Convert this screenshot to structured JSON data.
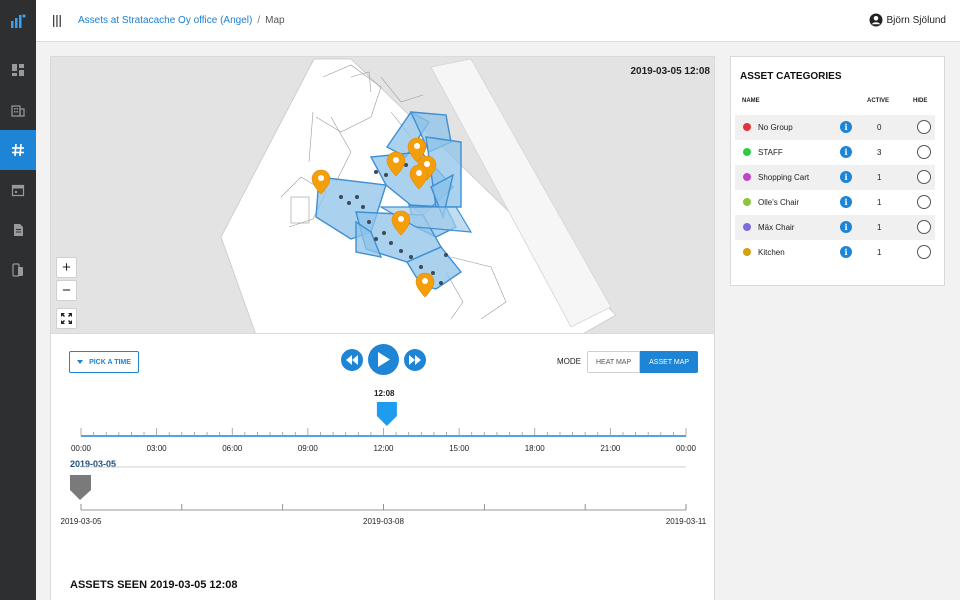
{
  "header": {
    "breadcrumb_link": "Assets at Stratacache Oy office (Angel)",
    "breadcrumb_sep": "/",
    "breadcrumb_current": "Map",
    "user_name": "Björn Sjölund"
  },
  "sidebar": {
    "items": [
      {
        "icon": "dashboard-icon"
      },
      {
        "icon": "building-icon"
      },
      {
        "icon": "hash-icon",
        "active": true
      },
      {
        "icon": "calendar-icon"
      },
      {
        "icon": "document-icon"
      },
      {
        "icon": "devices-icon"
      }
    ]
  },
  "map": {
    "timestamp": "2019-03-05 12:08",
    "zoom_in": "+",
    "zoom_out": "−",
    "marker_color": "#f59e0b",
    "zone_color": "#8ec3ea"
  },
  "controls": {
    "pick_time_label": "PICK A TIME",
    "mode_label": "MODE",
    "mode_options": [
      "HEAT MAP",
      "ASSET MAP"
    ],
    "mode_selected": "ASSET MAP",
    "accent_color": "#1d84d6"
  },
  "timeline": {
    "current_time": "12:08",
    "current_hour_fraction": 0.5056,
    "hour_labels": [
      "00:00",
      "03:00",
      "06:00",
      "09:00",
      "12:00",
      "15:00",
      "18:00",
      "21:00",
      "00:00"
    ],
    "selected_date": "2019-03-05",
    "date_labels": [
      "2019-03-05",
      "2019-03-08",
      "2019-03-11"
    ]
  },
  "assets_seen": "ASSETS SEEN 2019-03-05 12:08",
  "categories": {
    "title": "ASSET CATEGORIES",
    "col_name": "NAME",
    "col_active": "ACTIVE",
    "col_hide": "HIDE",
    "rows": [
      {
        "name": "No Group",
        "color": "#e2333a",
        "active": "0"
      },
      {
        "name": "STAFF",
        "color": "#2ecc40",
        "active": "3"
      },
      {
        "name": "Shopping Cart",
        "color": "#c444c9",
        "active": "1"
      },
      {
        "name": "Olle's Chair",
        "color": "#8cc63f",
        "active": "1"
      },
      {
        "name": "Mäx Chair",
        "color": "#7b6de0",
        "active": "1"
      },
      {
        "name": "Kitchen",
        "color": "#d4a012",
        "active": "1"
      }
    ]
  }
}
